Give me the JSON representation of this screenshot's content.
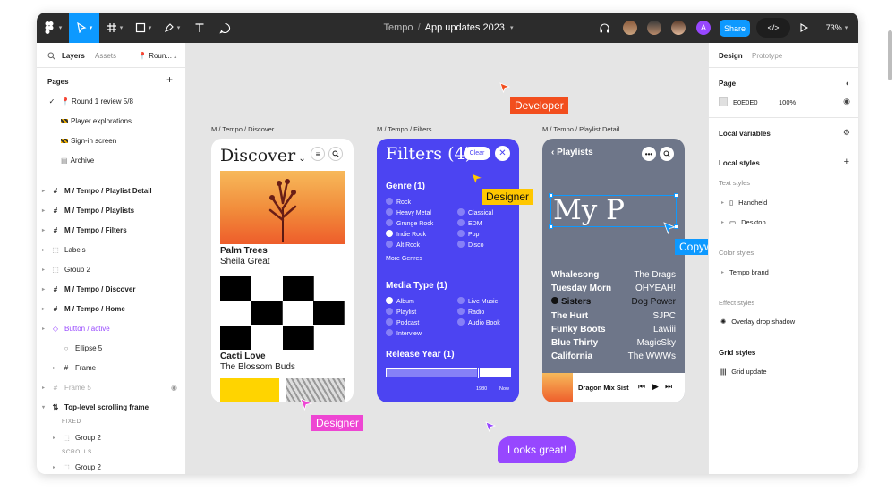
{
  "topbar": {
    "file_project": "Tempo",
    "file_sep": "/",
    "file_name": "App updates 2023",
    "share_label": "Share",
    "zoom": "73%"
  },
  "left_panel": {
    "tabs": {
      "layers": "Layers",
      "assets": "Assets",
      "page_selector": "Roun..."
    },
    "pages_header": "Pages",
    "pages": [
      "Round 1 review 5/8",
      "Player explorations",
      "Sign-in screen",
      "Archive"
    ],
    "layers": [
      "M / Tempo / Playlist Detail",
      "M / Tempo / Playlists",
      "M / Tempo / Filters",
      "Labels",
      "Group 2",
      "M / Tempo / Discover",
      "M / Tempo / Home",
      "Button / active",
      "Ellipse 5",
      "Frame",
      "Frame 5",
      "Top-level scrolling frame",
      "FIXED",
      "Group 2",
      "SCROLLS",
      "Group 2"
    ]
  },
  "canvas": {
    "frame_labels": [
      "M / Tempo / Discover",
      "M / Tempo / Filters",
      "M / Tempo / Playlist Detail"
    ],
    "cursors": {
      "developer": "Developer",
      "designer": "Designer",
      "copywriter": "Copywriter"
    },
    "comment": "Looks great!"
  },
  "discover": {
    "title": "Discover",
    "card1_title": "Palm Trees",
    "card1_artist": "Sheila Great",
    "card2_title": "Cacti Love",
    "card2_artist": "The Blossom Buds"
  },
  "filters": {
    "title": "Filters (4)",
    "clear": "Clear",
    "genre_header": "Genre (1)",
    "genres_left": [
      "Rock",
      "Heavy Metal",
      "Grunge Rock",
      "Indie Rock",
      "Alt Rock"
    ],
    "genres_right": [
      "Classical",
      "EDM",
      "Pop",
      "Disco"
    ],
    "more_genres": "More Genres",
    "media_header": "Media Type (1)",
    "media_left": [
      "Album",
      "Playlist",
      "Podcast",
      "Interview"
    ],
    "media_right": [
      "Live Music",
      "Radio",
      "Audio Book"
    ],
    "release_header": "Release Year (1)",
    "year_start": "1980",
    "year_end": "Now"
  },
  "playlist": {
    "back": "Playlists",
    "big_title": "My P",
    "rows": [
      [
        "Whalesong",
        "The Drags"
      ],
      [
        "Tuesday Morn",
        "OHYEAH!"
      ],
      [
        "Sisters",
        "Dog Power"
      ],
      [
        "The Hurt",
        "SJPC"
      ],
      [
        "Funky Boots",
        "Lawiii"
      ],
      [
        "Blue Thirty",
        "MagicSky"
      ],
      [
        "California",
        "The WWWs"
      ]
    ],
    "now_playing": "Dragon Mix Sist"
  },
  "right_panel": {
    "tabs": {
      "design": "Design",
      "prototype": "Prototype"
    },
    "page_header": "Page",
    "page_color": "E0E0E0",
    "page_opacity": "100%",
    "local_variables": "Local variables",
    "local_styles": "Local styles",
    "text_styles": "Text styles",
    "text_style_items": [
      "Handheld",
      "Desktop"
    ],
    "color_styles": "Color styles",
    "color_style_items": [
      "Tempo brand"
    ],
    "effect_styles": "Effect styles",
    "effect_style_items": [
      "Overlay drop shadow"
    ],
    "grid_styles": "Grid styles",
    "grid_style_items": [
      "Grid update"
    ]
  },
  "colors": {
    "topbar": "#2c2c2c",
    "accent": "#0d99ff",
    "canvas": "#e5e5e5",
    "filters_bg": "#4c44f2",
    "playlist_bg": "#6e7689",
    "developer": "#f24e1e",
    "designer_pink": "#ee46d3",
    "designer_yellow": "#ffc700",
    "copywriter": "#0d99ff",
    "comment": "#9747ff"
  }
}
